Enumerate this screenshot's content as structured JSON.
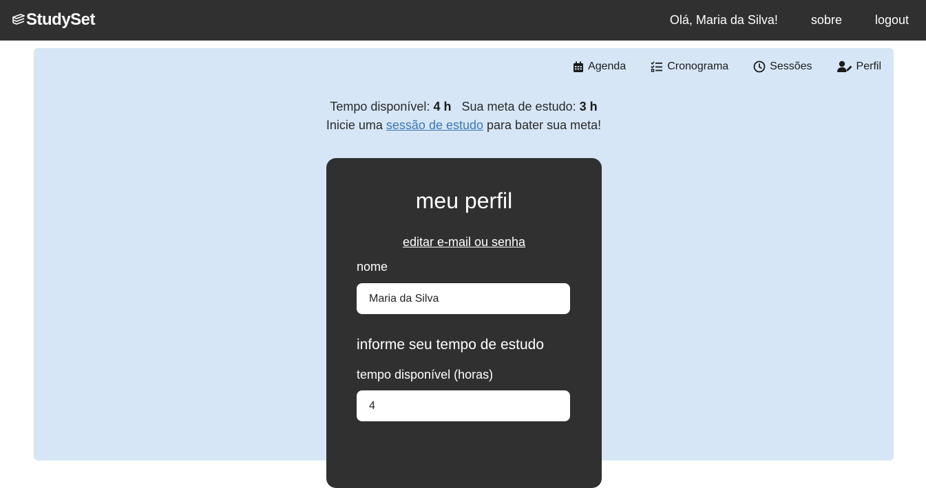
{
  "header": {
    "brand": "StudySet",
    "greeting": "Olá, Maria da Silva!",
    "about_label": "sobre",
    "logout_label": "logout"
  },
  "subnav": {
    "items": [
      {
        "label": "Agenda",
        "icon": "calendar-icon"
      },
      {
        "label": "Cronograma",
        "icon": "checklist-icon"
      },
      {
        "label": "Sessões",
        "icon": "clock-icon"
      },
      {
        "label": "Perfil",
        "icon": "user-edit-icon"
      }
    ]
  },
  "summary": {
    "available_label": "Tempo disponível:",
    "available_value": "4 h",
    "goal_label": "Sua meta de estudo:",
    "goal_value": "3 h",
    "cta_prefix": "Inicie uma",
    "cta_link": "sessão de estudo",
    "cta_suffix": "para bater sua meta!"
  },
  "profile": {
    "title": "meu perfil",
    "edit_link": "editar e-mail ou senha",
    "name_label": "nome",
    "name_value": "Maria da Silva",
    "study_section_title": "informe seu tempo de estudo",
    "available_hours_label": "tempo disponível (horas)",
    "available_hours_value": "4"
  },
  "colors": {
    "header_bg": "#303030",
    "panel_bg": "#d6e6f6",
    "card_bg": "#303030",
    "link": "#3a78b5"
  }
}
